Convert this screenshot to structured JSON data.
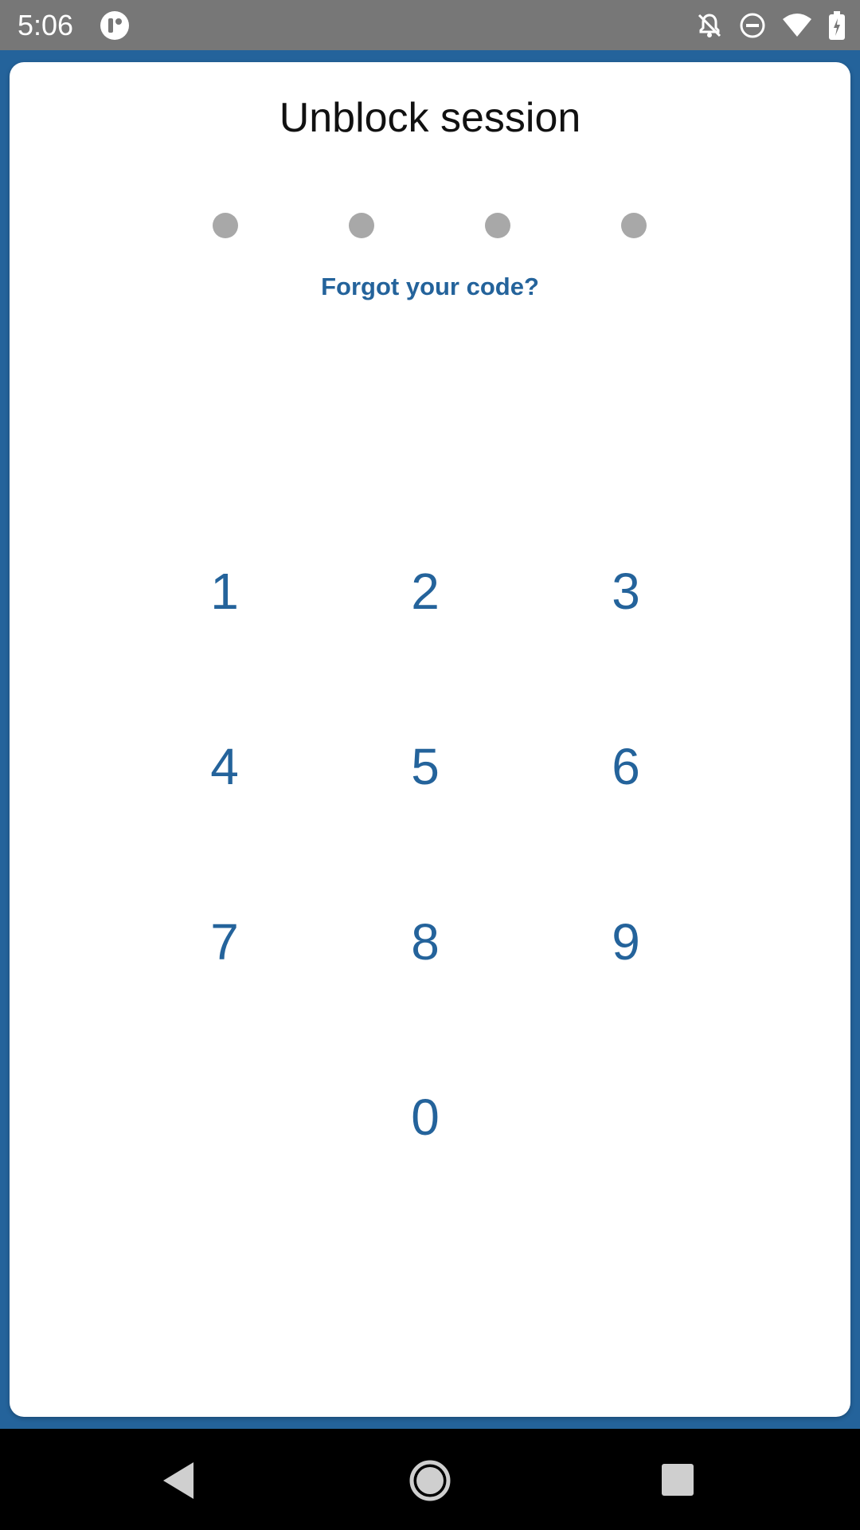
{
  "status_bar": {
    "time": "5:06",
    "icons": [
      "app-notification-icon",
      "notifications-off-icon",
      "do-not-disturb-icon",
      "wifi-icon",
      "battery-charging-icon"
    ]
  },
  "dialog": {
    "title": "Unblock session",
    "pin_length": 4,
    "pin_entered": 0,
    "forgot_link": "Forgot your code?"
  },
  "keypad": {
    "keys": [
      "1",
      "2",
      "3",
      "4",
      "5",
      "6",
      "7",
      "8",
      "9",
      "0"
    ]
  },
  "nav_bar": {
    "icons": [
      "back-icon",
      "home-icon",
      "recents-icon"
    ]
  },
  "colors": {
    "accent": "#24639b",
    "dot": "#a8a8a8",
    "status_bar": "#777777"
  }
}
